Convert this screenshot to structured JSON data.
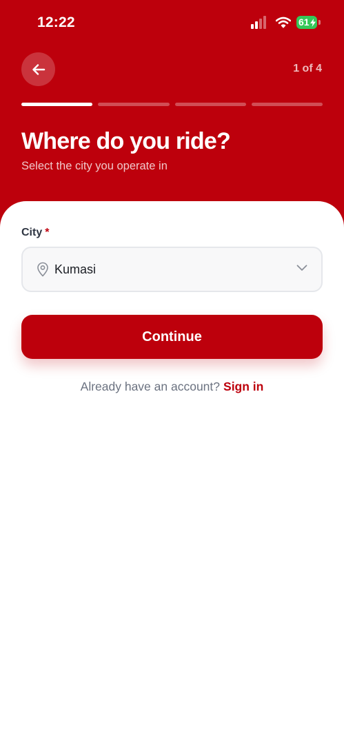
{
  "status_bar": {
    "time": "12:22",
    "battery_level": "61"
  },
  "header": {
    "step_indicator": "1 of 4",
    "progress": {
      "current_step": 1,
      "total_steps": 4
    },
    "title": "Where do you ride?",
    "subtitle": "Select the city you operate in"
  },
  "form": {
    "city_label": "City",
    "required_marker": "*",
    "city_value": "Kumasi"
  },
  "actions": {
    "continue_label": "Continue"
  },
  "footer": {
    "signin_prompt": "Already have an account?",
    "signin_link": "Sign in"
  },
  "colors": {
    "brand_red": "#bd000c",
    "white": "#ffffff",
    "battery_green": "#34c759",
    "muted_text": "#6b7280"
  },
  "icons": {
    "back": "arrow-left-icon",
    "location": "map-pin-icon",
    "dropdown": "chevron-down-icon",
    "cellular": "cellular-signal-icon",
    "wifi": "wifi-icon",
    "battery": "battery-charging-icon"
  }
}
